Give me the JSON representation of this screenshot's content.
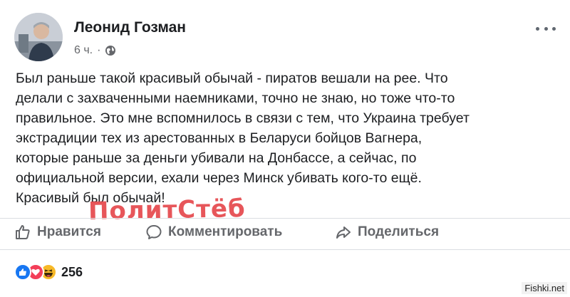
{
  "post": {
    "author": "Леонид Гозман",
    "time": "6 ч.",
    "separator": "·",
    "lines": [
      "Был раньше такой красивый обычай - пиратов вешали на рее. Что",
      "делали с захваченными наемниками, точно не знаю, но тоже что-то",
      "правильное. Это мне вспомнилось в связи с тем, что Украина требует",
      "экстрадиции тех из арестованных в Беларуси бойцов Вагнера,",
      "которые раньше за деньги убивали на Донбассе, а сейчас, по",
      "официальной версии, ехали через Минск убивать кого-то ещё.",
      "Красивый был обычай!"
    ]
  },
  "stamp": "ПолитСтёб",
  "actions": {
    "like": "Нравится",
    "comment": "Комментировать",
    "share": "Поделиться"
  },
  "reactions": {
    "count": "256",
    "icons": [
      "like-icon",
      "love-icon",
      "haha-icon"
    ],
    "colors": {
      "like": "#1877f2",
      "love": "#f33e58",
      "haha": "#f7b928"
    }
  },
  "watermark": "Fishki.net"
}
